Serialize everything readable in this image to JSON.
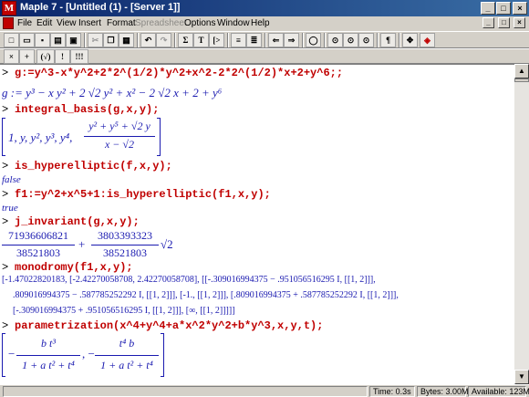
{
  "window": {
    "title": "Maple 7 - [Untitled (1) - [Server 1]]",
    "app_icon_letter": "M",
    "controls": [
      "_",
      "□",
      "×"
    ]
  },
  "menu": {
    "items": [
      "File",
      "Edit",
      "View",
      "Insert",
      "Format",
      "Spreadsheet",
      "Options",
      "Window",
      "Help"
    ],
    "disabled": "Spreadsheet",
    "mdi_controls": [
      "_",
      "□",
      "×"
    ]
  },
  "toolbar1": {
    "icons": [
      "new-icon",
      "open-icon",
      "save-icon",
      "print-icon",
      "cut-icon",
      "copy-icon",
      "paste-icon",
      "undo-icon",
      "redo-icon",
      "sigma-icon",
      "text-icon",
      "prompt-icon",
      "indent-icon",
      "outdent-icon",
      "back-icon",
      "forward-icon",
      "stop-icon",
      "zoom-100-icon",
      "zoom-150-icon",
      "zoom-200-icon",
      "paragraph-icon",
      "expand-icon",
      "restart-icon"
    ],
    "glyphs": {
      "sigma": "Σ",
      "text": "T",
      "prompt": "[>",
      "paragraph": "¶"
    }
  },
  "toolbar2": {
    "buttons": [
      "×",
      "+",
      "(√)",
      "!",
      "!!!"
    ]
  },
  "worksheet": {
    "prompt": ">",
    "cmd1": "g:=y^3-x*y^2+2*2^(1/2)*y^2+x^2-2*2^(1/2)*x+2+y^6;;",
    "out1": "g := y³ − x y² + 2 √2 y² + x² − 2 √2 x + 2 + y⁶",
    "cmd2": "integral_basis(g,x,y);",
    "out2_items": "1, y, y², y³, y⁴,",
    "out2_num": "y² + y⁵ + √2 y",
    "out2_den": "x − √2",
    "cmd3": "is_hyperelliptic(f,x,y);",
    "out3": "false",
    "cmd4": "f1:=y^2+x^5+1:is_hyperelliptic(f1,x,y);",
    "out4": "true",
    "cmd5": "j_invariant(g,x,y);",
    "out5_num1": "71936606821",
    "out5_den1": "38521803",
    "out5_plus": "+",
    "out5_num2": "3803393323",
    "out5_den2": "38521803",
    "out5_tail": "√2",
    "cmd6": "monodromy(f1,x,y);",
    "out6_l1": "[-1.47022820183, [-2.42270058708, 2.42270058708], [[-.309016994375 − .951056516295 I, [[1, 2]]],",
    "out6_l2": ".809016994375 − .587785252292 I, [[1, 2]]], [-1., [[1, 2]]], [.809016994375 + .587785252292 I, [[1, 2]]],",
    "out6_l3": "[-.309016994375 + .951056516295 I, [[1, 2]]], [∞, [[1, 2]]]]]",
    "cmd7": "parametrization(x^4+y^4+a*x^2*y^2+b*y^3,x,y,t);",
    "out7_minus1": "−",
    "out7_num1": "b t³",
    "out7_den1": "1 + a t² + t⁴",
    "out7_sep": ", −",
    "out7_num2": "t⁴ b",
    "out7_den2": "1 + a t² + t⁴"
  },
  "status": {
    "time": "Time:  0.3s",
    "bytes": "Bytes:  3.00M",
    "available": "Available:  123M"
  }
}
